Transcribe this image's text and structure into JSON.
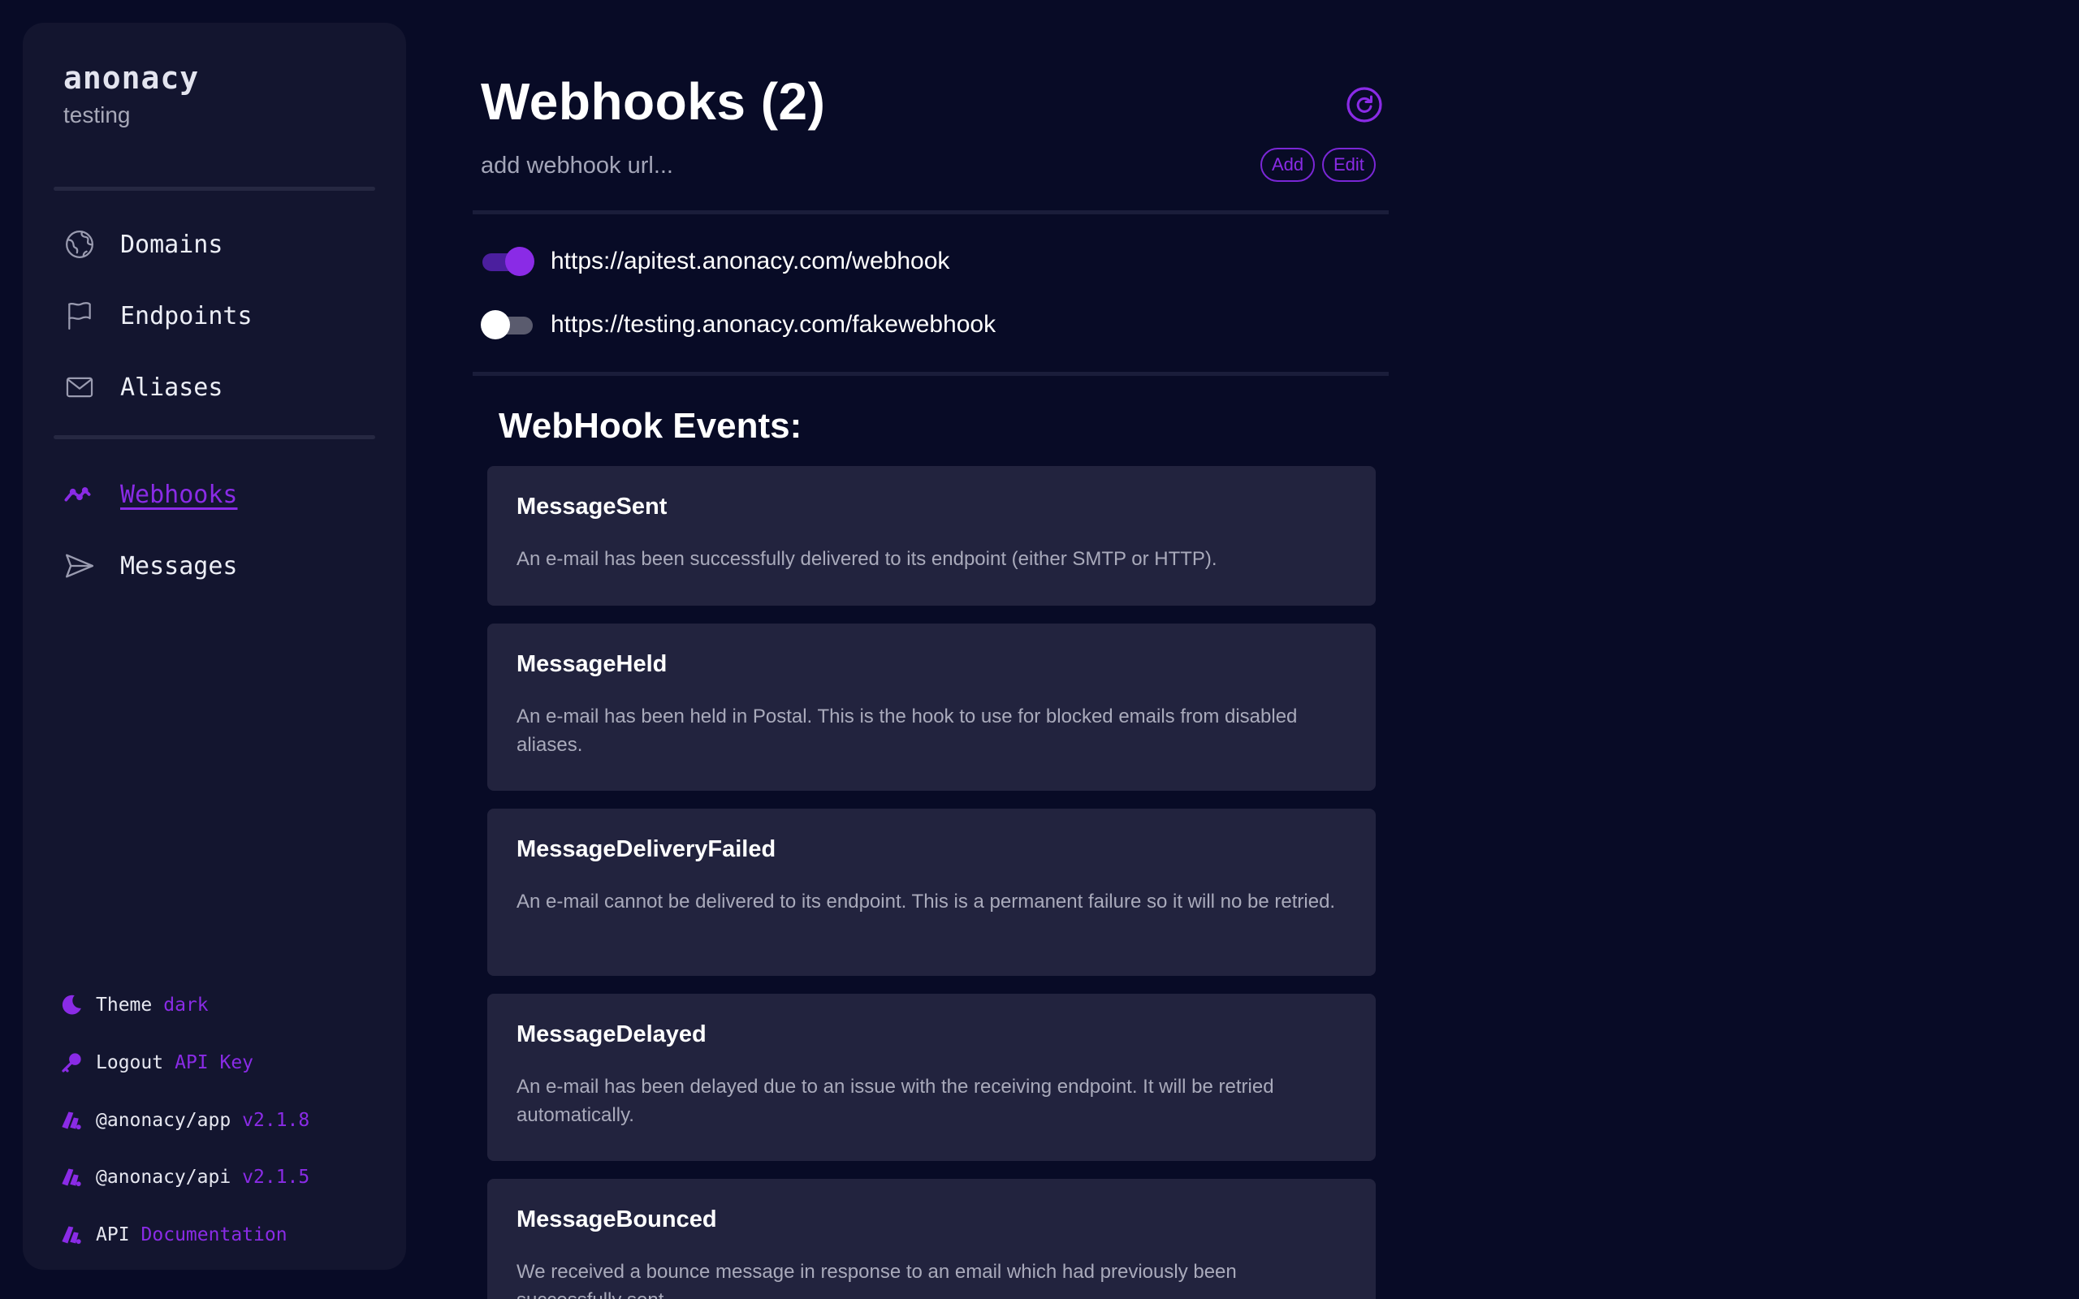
{
  "brand": {
    "name": "anonacy",
    "subtitle": "testing"
  },
  "nav": {
    "primary": [
      {
        "label": "Domains",
        "icon": "globe-icon"
      },
      {
        "label": "Endpoints",
        "icon": "flag-icon"
      },
      {
        "label": "Aliases",
        "icon": "envelope-icon"
      }
    ],
    "secondary": [
      {
        "label": "Webhooks",
        "icon": "activity-icon",
        "active": true
      },
      {
        "label": "Messages",
        "icon": "send-icon"
      }
    ]
  },
  "footer": [
    {
      "label": "Theme",
      "value": "dark",
      "icon": "moon-icon"
    },
    {
      "label": "Logout",
      "value": "API Key",
      "icon": "key-icon"
    },
    {
      "label": "@anonacy/app",
      "value": "v2.1.8",
      "icon": "anonacy-logo-icon"
    },
    {
      "label": "@anonacy/api",
      "value": "v2.1.5",
      "icon": "anonacy-logo-icon"
    },
    {
      "label": "API",
      "value": "Documentation",
      "icon": "anonacy-logo-icon"
    }
  ],
  "header": {
    "title": "Webhooks (2)",
    "input_placeholder": "add webhook url...",
    "add_label": "Add",
    "edit_label": "Edit"
  },
  "webhooks": [
    {
      "url": "https://apitest.anonacy.com/webhook",
      "enabled": true
    },
    {
      "url": "https://testing.anonacy.com/fakewebhook",
      "enabled": false
    }
  ],
  "events": {
    "title": "WebHook Events:",
    "items": [
      {
        "name": "MessageSent",
        "description": "An e-mail has been successfully delivered to its endpoint (either SMTP or HTTP)."
      },
      {
        "name": "MessageHeld",
        "description": "An e-mail has been held in Postal. This is the hook to use for blocked emails from disabled aliases."
      },
      {
        "name": "MessageDeliveryFailed",
        "description": "An e-mail cannot be delivered to its endpoint. This is a permanent failure so it will no be retried."
      },
      {
        "name": "MessageDelayed",
        "description": "An e-mail has been delayed due to an issue with the receiving endpoint. It will be retried automatically."
      },
      {
        "name": "MessageBounced",
        "description": "We received a bounce message in response to an email which had previously been successfully sent."
      }
    ]
  },
  "colors": {
    "background": "#080b26",
    "sidebar": "#13152f",
    "accent": "#8a2be6",
    "card": "#22233e"
  }
}
